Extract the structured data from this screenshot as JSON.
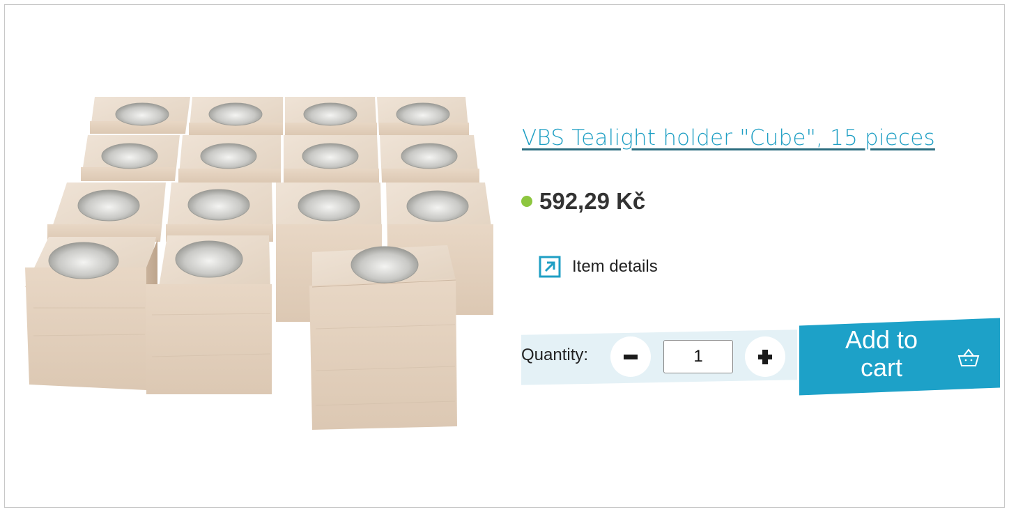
{
  "product": {
    "title": "VBS Tealight holder \"Cube\", 15 pieces",
    "price": "592,29 Kč",
    "stock_color": "#8dc63f",
    "image_icon": "product-photo"
  },
  "details_link": {
    "label": "Item details",
    "icon": "external-link-icon"
  },
  "quantity": {
    "label": "Quantity:",
    "value": "1",
    "minus_icon": "minus-icon",
    "plus_icon": "plus-icon"
  },
  "cart": {
    "label": "Add to cart",
    "icon": "basket-icon"
  },
  "colors": {
    "accent": "#1da1c8",
    "qty_bg": "#e4f1f6"
  }
}
